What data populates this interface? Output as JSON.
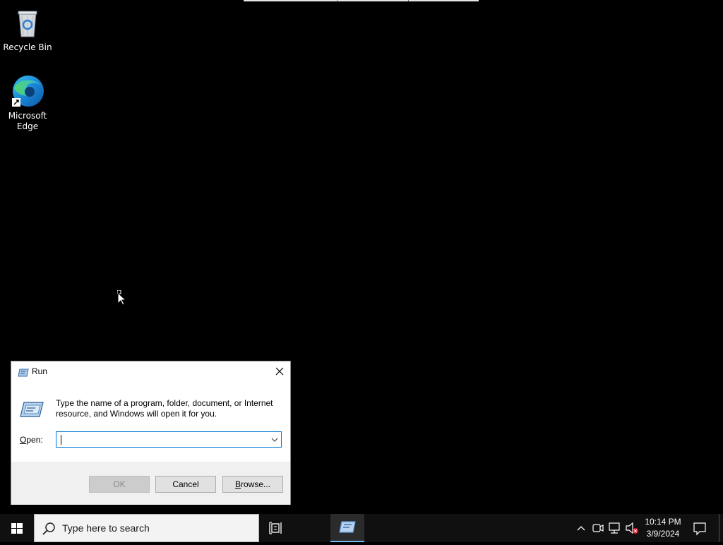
{
  "desktop": {
    "icons": [
      {
        "label": "Recycle Bin",
        "icon": "recycle-bin-icon"
      },
      {
        "label": "Microsoft Edge",
        "icon": "edge-icon"
      }
    ]
  },
  "run_dialog": {
    "title": "Run",
    "description": "Type the name of a program, folder, document, or Internet resource, and Windows will open it for you.",
    "open_label_prefix": "O",
    "open_label_rest": "pen:",
    "open_value": "",
    "ok_label": "OK",
    "cancel_label": "Cancel",
    "browse_label_prefix": "B",
    "browse_label_rest": "rowse..."
  },
  "taskbar": {
    "search_placeholder": "Type here to search",
    "clock_time": "10:14 PM",
    "clock_date": "3/9/2024"
  },
  "colors": {
    "desktop_bg": "#000000",
    "taskbar_bg": "#101010",
    "accent": "#0078d7",
    "active_task_underline": "#76b9ed"
  }
}
